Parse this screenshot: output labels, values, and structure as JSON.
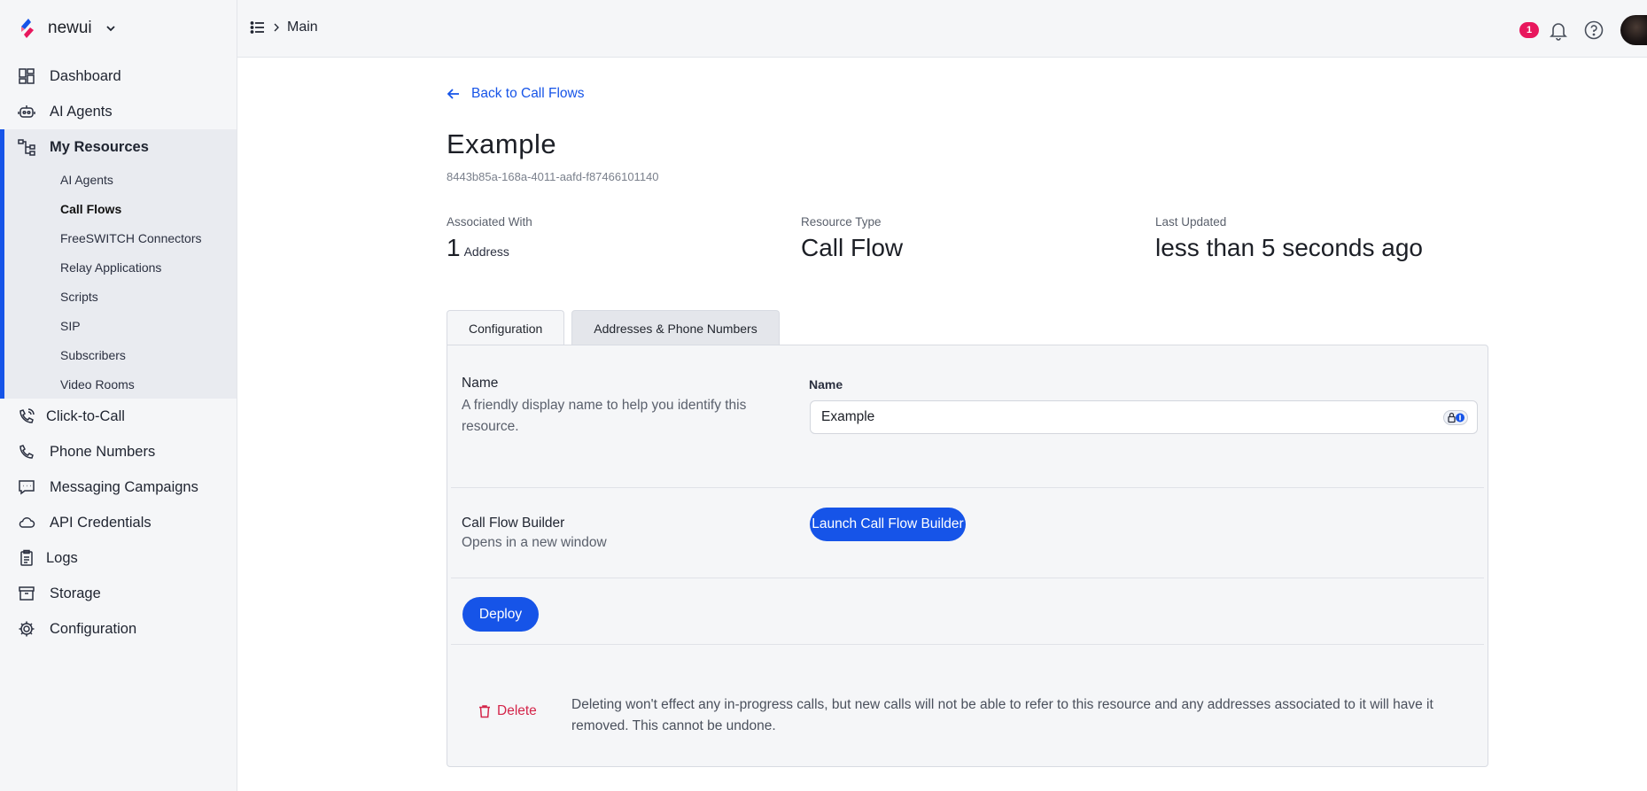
{
  "brand": {
    "name": "newui"
  },
  "sidebar": {
    "items": [
      {
        "label": "Dashboard",
        "icon": "dashboard-icon"
      },
      {
        "label": "AI Agents",
        "icon": "robot-icon"
      }
    ],
    "group": {
      "label": "My Resources",
      "icon": "resources-icon",
      "sub_items": [
        {
          "label": "AI Agents"
        },
        {
          "label": "Call Flows",
          "active": true
        },
        {
          "label": "FreeSWITCH Connectors"
        },
        {
          "label": "Relay Applications"
        },
        {
          "label": "Scripts"
        },
        {
          "label": "SIP"
        },
        {
          "label": "Subscribers"
        },
        {
          "label": "Video Rooms"
        }
      ]
    },
    "items_after": [
      {
        "label": "Click-to-Call",
        "icon": "phone-wave-icon"
      },
      {
        "label": "Phone Numbers",
        "icon": "phone-icon"
      },
      {
        "label": "Messaging Campaigns",
        "icon": "message-icon"
      },
      {
        "label": "API Credentials",
        "icon": "cloud-icon"
      },
      {
        "label": "Logs",
        "icon": "clipboard-icon"
      },
      {
        "label": "Storage",
        "icon": "archive-icon"
      },
      {
        "label": "Configuration",
        "icon": "gear-icon"
      }
    ]
  },
  "topbar": {
    "breadcrumb": "Main",
    "notification_count": "1"
  },
  "page": {
    "back_link": "Back to Call Flows",
    "title": "Example",
    "uuid": "8443b85a-168a-4011-aafd-f87466101140",
    "stats": {
      "associated_label": "Associated With",
      "associated_count": "1",
      "associated_unit": "Address",
      "type_label": "Resource Type",
      "type_value": "Call Flow",
      "updated_label": "Last Updated",
      "updated_value": "less than 5 seconds ago"
    },
    "tabs": [
      {
        "label": "Configuration",
        "active": true
      },
      {
        "label": "Addresses & Phone Numbers",
        "active": false
      }
    ],
    "name_section": {
      "label": "Name",
      "description": "A friendly display name to help you identify this resource.",
      "field_label": "Name",
      "field_value": "Example"
    },
    "builder_section": {
      "label": "Call Flow Builder",
      "description": "Opens in a new window",
      "button": "Launch Call Flow Builder"
    },
    "deploy_button": "Deploy",
    "delete_button": "Delete",
    "delete_warning": "Deleting won't effect any in-progress calls, but new calls will not be able to refer to this resource and any addresses associated to it will have it removed. This cannot be undone."
  },
  "colors": {
    "accent": "#1654e8",
    "danger": "#d4254a",
    "badge": "#e8175d"
  }
}
